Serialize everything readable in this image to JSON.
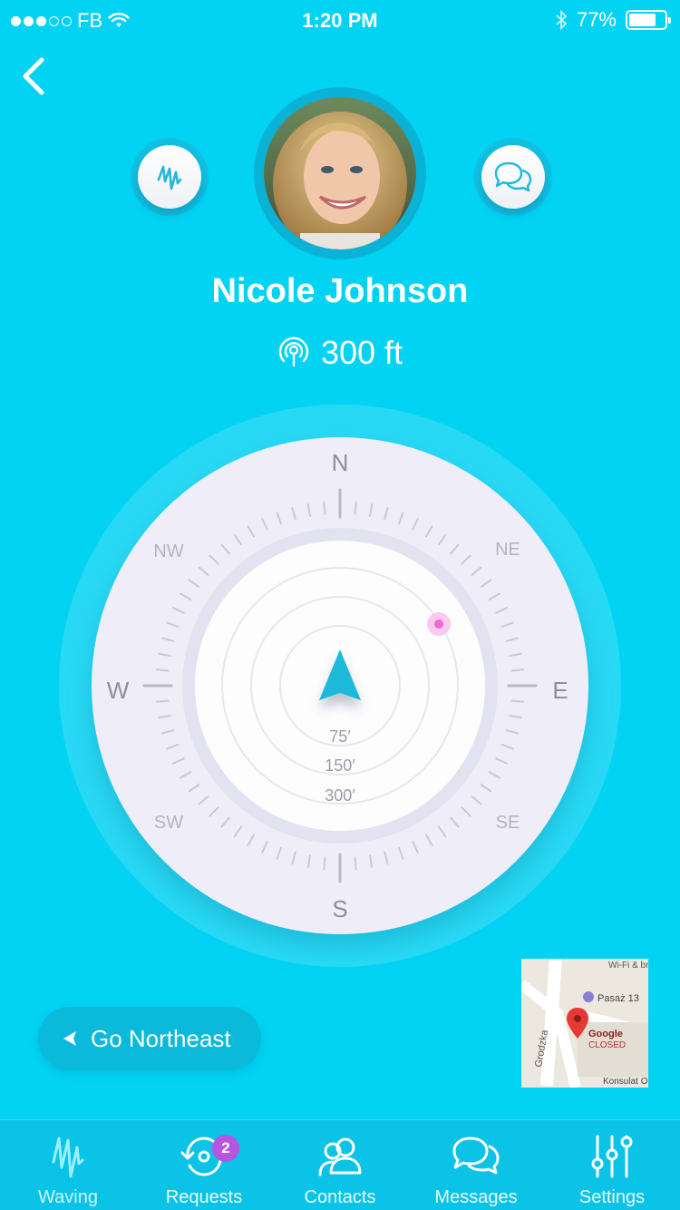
{
  "status_bar": {
    "carrier": "FB",
    "time": "1:20 PM",
    "battery": "77%",
    "battery_level": 0.77,
    "signal_strength": 3
  },
  "icons": {
    "back": "chevron-left-icon",
    "wave": "wave-icon",
    "chat": "chat-bubbles-icon",
    "distance": "radar-pin-icon",
    "nav_arrow": "navigation-arrow-icon"
  },
  "profile": {
    "name": "Nicole Johnson",
    "distance": "300 ft"
  },
  "compass": {
    "directions": {
      "n": "N",
      "ne": "NE",
      "e": "E",
      "se": "SE",
      "s": "S",
      "sw": "SW",
      "w": "W",
      "nw": "NW"
    },
    "ranges": [
      "75′",
      "150′",
      "300′"
    ]
  },
  "navigation_hint": {
    "label": "Go Northeast"
  },
  "map": {
    "places": {
      "top": "Wi-Fi & bre",
      "poi": "Pasaż 13",
      "street": "Grodzka",
      "business": "Google",
      "business_status": "CLOSED",
      "bottom": "Konsulat O"
    }
  },
  "tabs": [
    {
      "label": "Waving"
    },
    {
      "label": "Requests",
      "badge": "2"
    },
    {
      "label": "Contacts"
    },
    {
      "label": "Messages"
    },
    {
      "label": "Settings"
    }
  ],
  "colors": {
    "background": "#03D3F3",
    "accent_pink": "#F268D8",
    "arrow": "#1EB9DB",
    "badge": "#B655E0"
  }
}
